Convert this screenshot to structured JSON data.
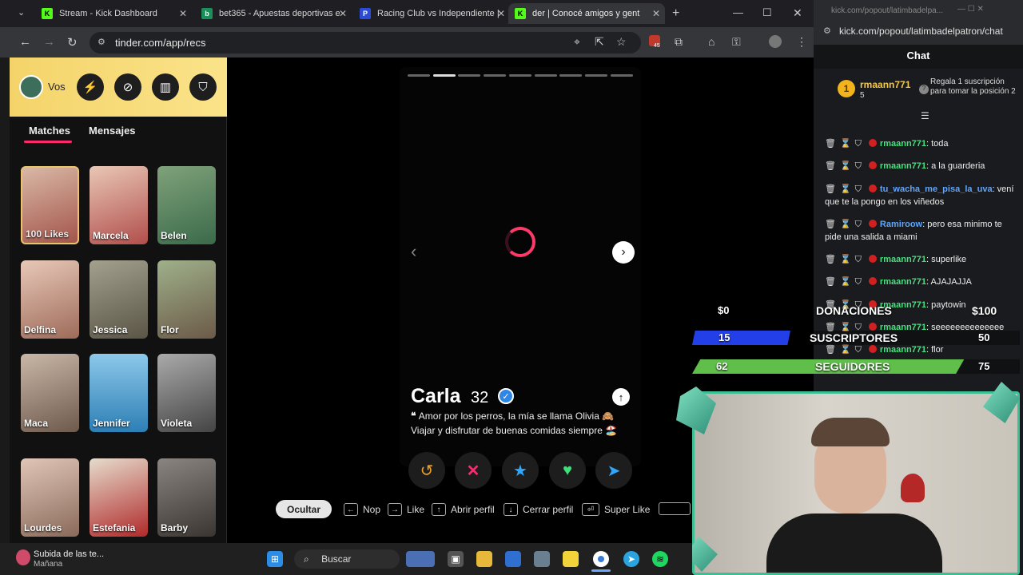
{
  "browser": {
    "tabs": [
      {
        "label": "Stream - Kick Dashboard",
        "favicon": "kick-icon"
      },
      {
        "label": "bet365 - Apuestas deportivas e",
        "favicon": "bet365-icon"
      },
      {
        "label": "Racing Club vs Independiente |",
        "favicon": "promiedos-icon"
      },
      {
        "label": "der | Conocé amigos y gent",
        "favicon": "tinder-icon"
      }
    ],
    "url": "tinder.com/app/recs",
    "extension_badge": "45"
  },
  "sidebar": {
    "vos_label": "Vos",
    "tabs": [
      "Matches",
      "Mensajes"
    ],
    "likes_label": "100 Likes",
    "matches": [
      "Marcela",
      "Belen",
      "Delfina",
      "Jessica",
      "Flor",
      "Maca",
      "Jennifer",
      "Violeta",
      "Lourdes",
      "Estefania",
      "Barby"
    ]
  },
  "profile": {
    "name": "Carla",
    "age": "32",
    "bio_line1": "Amor por los perros, la mía se llama Olivia 🙈",
    "bio_line2": "Viajar y disfrutar de buenas comidas siempre 🏖️",
    "photo_count": 9,
    "current_photo": 2
  },
  "shortcuts": {
    "ocultar": "Ocultar",
    "nop": "Nop",
    "like": "Like",
    "abrir": "Abrir perfil",
    "cerrar": "Cerrar perfil",
    "superlike": "Super Like"
  },
  "kick": {
    "url": "kick.com/popout/latimbadelpatron/chat",
    "url_short": "kick.com/popout/latimbadelpa...",
    "chat_title": "Chat",
    "pinned_user": "rmaann771",
    "pinned_count": "5",
    "pinned_text": "Regala 1 suscripción para tomar la posición 2",
    "messages": [
      {
        "user": "rmaann771",
        "text": "toda",
        "color": "#4ade80"
      },
      {
        "user": "rmaann771",
        "text": "a la guarderia",
        "color": "#4ade80"
      },
      {
        "user": "tu_wacha_me_pisa_la_uva",
        "text": "vení que te la pongo en los viñedos",
        "color": "#60a5fa"
      },
      {
        "user": "Ramiroow",
        "text": "pero esa minimo te pide una salida a miami",
        "color": "#60a5fa"
      },
      {
        "user": "rmaann771",
        "text": "superlike",
        "color": "#4ade80"
      },
      {
        "user": "rmaann771",
        "text": "AJAJAJJA",
        "color": "#4ade80"
      },
      {
        "user": "rmaann771",
        "text": "paytowin",
        "color": "#4ade80"
      },
      {
        "user": "rmaann771",
        "text": "seeeeeeeeeeeeee",
        "color": "#4ade80"
      },
      {
        "user": "rmaann771",
        "text": "flor",
        "color": "#4ade80"
      }
    ]
  },
  "overlay": {
    "donaciones_label": "DONACIONES",
    "donaciones_current": "$0",
    "donaciones_goal": "$100",
    "donaciones_fraction": 0,
    "suscriptores_label": "SUSCRIPTORES",
    "suscriptores_current": "15",
    "suscriptores_goal": "50",
    "suscriptores_fraction": 0.3,
    "seguidores_label": "SEGUIDORES",
    "seguidores_current": "62",
    "seguidores_goal": "75",
    "seguidores_fraction": 0.83
  },
  "taskbar": {
    "weather_title": "Subida de las te...",
    "weather_sub": "Mañana",
    "search_label": "Buscar"
  }
}
